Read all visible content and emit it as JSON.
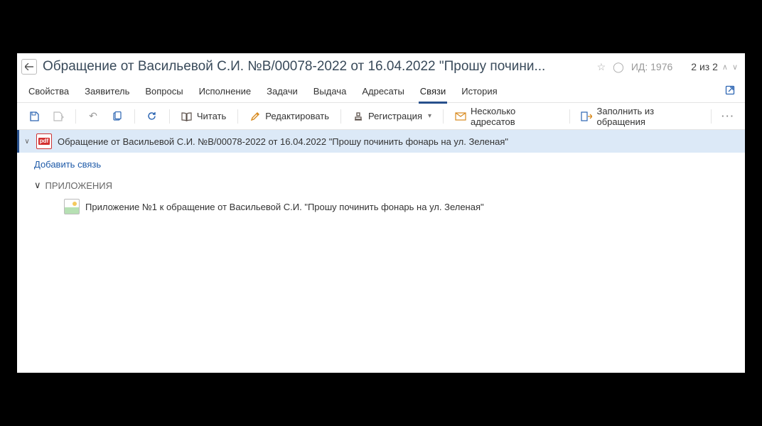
{
  "header": {
    "title": "Обращение от Васильевой С.И. №В/00078-2022 от 16.04.2022 \"Прошу почини...",
    "id_label": "ИД: 1976",
    "pager": "2 из 2"
  },
  "tabs": [
    {
      "key": "properties",
      "label": "Свойства"
    },
    {
      "key": "applicant",
      "label": "Заявитель"
    },
    {
      "key": "questions",
      "label": "Вопросы"
    },
    {
      "key": "execution",
      "label": "Исполнение"
    },
    {
      "key": "tasks",
      "label": "Задачи"
    },
    {
      "key": "issue",
      "label": "Выдача"
    },
    {
      "key": "addresses",
      "label": "Адресаты"
    },
    {
      "key": "links",
      "label": "Связи",
      "active": true
    },
    {
      "key": "history",
      "label": "История"
    }
  ],
  "toolbar": {
    "read": "Читать",
    "edit": "Редактировать",
    "register": "Регистрация",
    "multiAddr": "Несколько адресатов",
    "fillFrom": "Заполнить из обращения"
  },
  "tree": {
    "root_label": "Обращение от Васильевой С.И. №В/00078-2022 от 16.04.2022 \"Прошу починить фонарь на ул. Зеленая\"",
    "add_link": "Добавить связь",
    "section": "ПРИЛОЖЕНИЯ",
    "attachment": "Приложение №1 к обращение от Васильевой С.И. \"Прошу починить фонарь на ул. Зеленая\""
  }
}
